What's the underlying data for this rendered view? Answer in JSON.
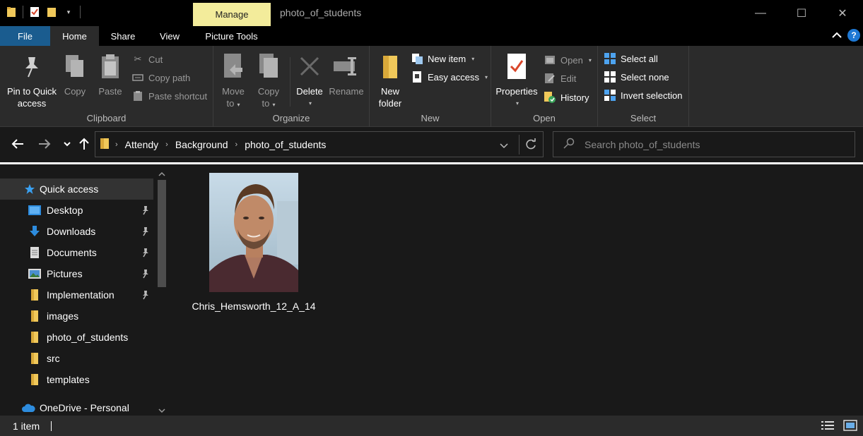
{
  "window": {
    "title": "photo_of_students",
    "context_tab": "Manage",
    "minimize": "—",
    "maximize": "☐",
    "close": "✕"
  },
  "tabs": {
    "file": "File",
    "home": "Home",
    "share": "Share",
    "view": "View",
    "picture_tools": "Picture Tools"
  },
  "ribbon": {
    "clipboard": {
      "label": "Clipboard",
      "pin_line1": "Pin to Quick",
      "pin_line2": "access",
      "copy": "Copy",
      "paste": "Paste",
      "cut": "Cut",
      "copy_path": "Copy path",
      "paste_shortcut": "Paste shortcut"
    },
    "organize": {
      "label": "Organize",
      "move_line1": "Move",
      "move_line2": "to",
      "copy_line1": "Copy",
      "copy_line2": "to",
      "delete": "Delete",
      "rename": "Rename"
    },
    "new": {
      "label": "New",
      "new_folder_line1": "New",
      "new_folder_line2": "folder",
      "new_item": "New item",
      "easy_access": "Easy access"
    },
    "open": {
      "label": "Open",
      "properties": "Properties",
      "open": "Open",
      "edit": "Edit",
      "history": "History"
    },
    "select": {
      "label": "Select",
      "select_all": "Select all",
      "select_none": "Select none",
      "invert_selection": "Invert selection"
    }
  },
  "address": {
    "crumbs": [
      "Attendy",
      "Background",
      "photo_of_students"
    ],
    "search_placeholder": "Search photo_of_students"
  },
  "navpane": {
    "quick_access": "Quick access",
    "items": [
      {
        "label": "Desktop",
        "icon": "desktop-icon",
        "pinned": true
      },
      {
        "label": "Downloads",
        "icon": "downloads-icon",
        "pinned": true
      },
      {
        "label": "Documents",
        "icon": "documents-icon",
        "pinned": true
      },
      {
        "label": "Pictures",
        "icon": "pictures-icon",
        "pinned": true
      },
      {
        "label": "Implementation",
        "icon": "folder-icon",
        "pinned": true
      },
      {
        "label": "images",
        "icon": "folder-icon",
        "pinned": false
      },
      {
        "label": "photo_of_students",
        "icon": "folder-icon",
        "pinned": false
      },
      {
        "label": "src",
        "icon": "folder-icon",
        "pinned": false
      },
      {
        "label": "templates",
        "icon": "folder-icon",
        "pinned": false
      }
    ],
    "onedrive": "OneDrive - Personal"
  },
  "content": {
    "files": [
      {
        "name": "Chris_Hemsworth_12_A_14",
        "type": "image"
      }
    ]
  },
  "status": {
    "item_count": "1 item"
  },
  "colors": {
    "file_tab": "#1a5c8f",
    "manage_tab": "#f3ec9b",
    "folder": "#f0c85a",
    "accent_blue": "#1e78d4"
  }
}
